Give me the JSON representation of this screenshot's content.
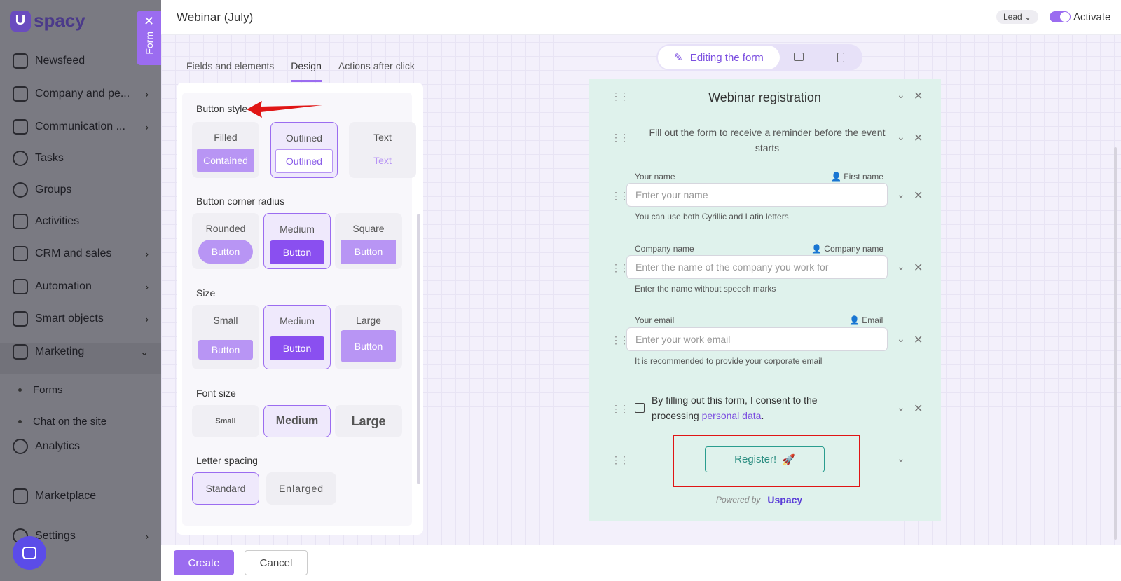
{
  "sidebar": {
    "logo_text": "spacy",
    "logo_letter": "U",
    "items": [
      {
        "label": "Newsfeed",
        "icon": "home-icon"
      },
      {
        "label": "Company and pe...",
        "icon": "building-icon"
      },
      {
        "label": "Communication ...",
        "icon": "edit-icon"
      },
      {
        "label": "Tasks",
        "icon": "check-icon"
      },
      {
        "label": "Groups",
        "icon": "users-icon"
      },
      {
        "label": "Activities",
        "icon": "calendar-icon"
      },
      {
        "label": "CRM and sales",
        "icon": "database-icon"
      },
      {
        "label": "Automation",
        "icon": "lightning-icon"
      },
      {
        "label": "Smart objects",
        "icon": "smart-object-icon"
      },
      {
        "label": "Marketing",
        "icon": "marketing-icon"
      },
      {
        "label": "Analytics",
        "icon": "chart-icon"
      },
      {
        "label": "Marketplace",
        "icon": "store-icon"
      },
      {
        "label": "Settings",
        "icon": "gear-icon"
      }
    ],
    "sub_items": [
      "Forms",
      "Chat on the site"
    ]
  },
  "form_tab": {
    "label": "Form"
  },
  "header": {
    "title": "Webinar (July)",
    "lead_select": "Lead",
    "activate_label": "Activate",
    "activate_on": true
  },
  "tabs": [
    "Fields and elements",
    "Design",
    "Actions after click"
  ],
  "active_tab": "Design",
  "design": {
    "button_style": {
      "title": "Button style",
      "options": [
        {
          "caption": "Filled",
          "demo": "Contained"
        },
        {
          "caption": "Outlined",
          "demo": "Outlined"
        },
        {
          "caption": "Text",
          "demo": "Text"
        }
      ],
      "selected": "Outlined"
    },
    "corner_radius": {
      "title": "Button corner radius",
      "options": [
        {
          "caption": "Rounded",
          "demo": "Button"
        },
        {
          "caption": "Medium",
          "demo": "Button"
        },
        {
          "caption": "Square",
          "demo": "Button"
        }
      ],
      "selected": "Medium"
    },
    "size": {
      "title": "Size",
      "options": [
        {
          "caption": "Small",
          "demo": "Button"
        },
        {
          "caption": "Medium",
          "demo": "Button"
        },
        {
          "caption": "Large",
          "demo": "Button"
        }
      ],
      "selected": "Medium"
    },
    "font_size": {
      "title": "Font size",
      "options": [
        "Small",
        "Medium",
        "Large"
      ],
      "selected": "Medium"
    },
    "letter_spacing": {
      "title": "Letter spacing",
      "options": [
        "Standard",
        "Enlarged"
      ],
      "selected": "Standard"
    }
  },
  "preview_modes": {
    "active": "Editing the form"
  },
  "preview": {
    "title": "Webinar registration",
    "subtitle": "Fill out the form to receive a reminder before the event starts",
    "fields": [
      {
        "label": "Your name",
        "mapping": "First name",
        "placeholder": "Enter your name",
        "hint": "You can use both Cyrillic and Latin letters"
      },
      {
        "label": "Company name",
        "mapping": "Company name",
        "placeholder": "Enter the name of the company you work for",
        "hint": "Enter the name without speech marks"
      },
      {
        "label": "Your email",
        "mapping": "Email",
        "placeholder": "Enter your work email",
        "hint": "It is recommended to provide your corporate email"
      }
    ],
    "consent_text": "By filling out this form, I consent to the processing",
    "consent_link": "personal data",
    "consent_end": ".",
    "register_label": "Register!",
    "powered_by": "Powered by",
    "powered_logo": "Uspacy"
  },
  "footer": {
    "create": "Create",
    "cancel": "Cancel"
  },
  "colors": {
    "accent": "#9b6cf0",
    "highlight": "#e01515",
    "preview_bg": "#dff2ec",
    "button_teal": "#2a9d8f"
  }
}
